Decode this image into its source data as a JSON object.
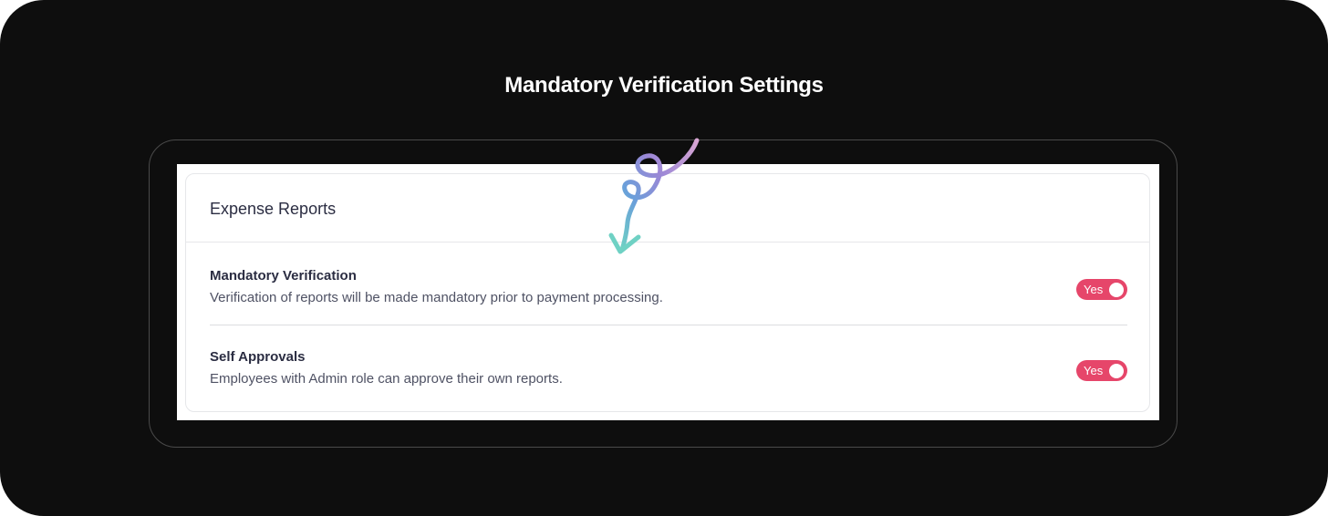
{
  "page": {
    "title": "Mandatory Verification Settings"
  },
  "card": {
    "title": "Expense Reports",
    "settings": [
      {
        "label": "Mandatory Verification",
        "description": "Verification of reports will be made mandatory prior to payment processing.",
        "toggle_label": "Yes",
        "enabled": true
      },
      {
        "label": "Self Approvals",
        "description": "Employees with Admin role can approve their own reports.",
        "toggle_label": "Yes",
        "enabled": true
      }
    ]
  },
  "colors": {
    "background": "#0e0e0e",
    "toggle_on": "#e6466a",
    "text_primary": "#2b2d42",
    "text_secondary": "#4f5264",
    "arrow_gradient_start": "#c79ad8",
    "arrow_gradient_end": "#6fd1c4"
  },
  "icons": {
    "annotation": "curly-arrow-icon"
  }
}
